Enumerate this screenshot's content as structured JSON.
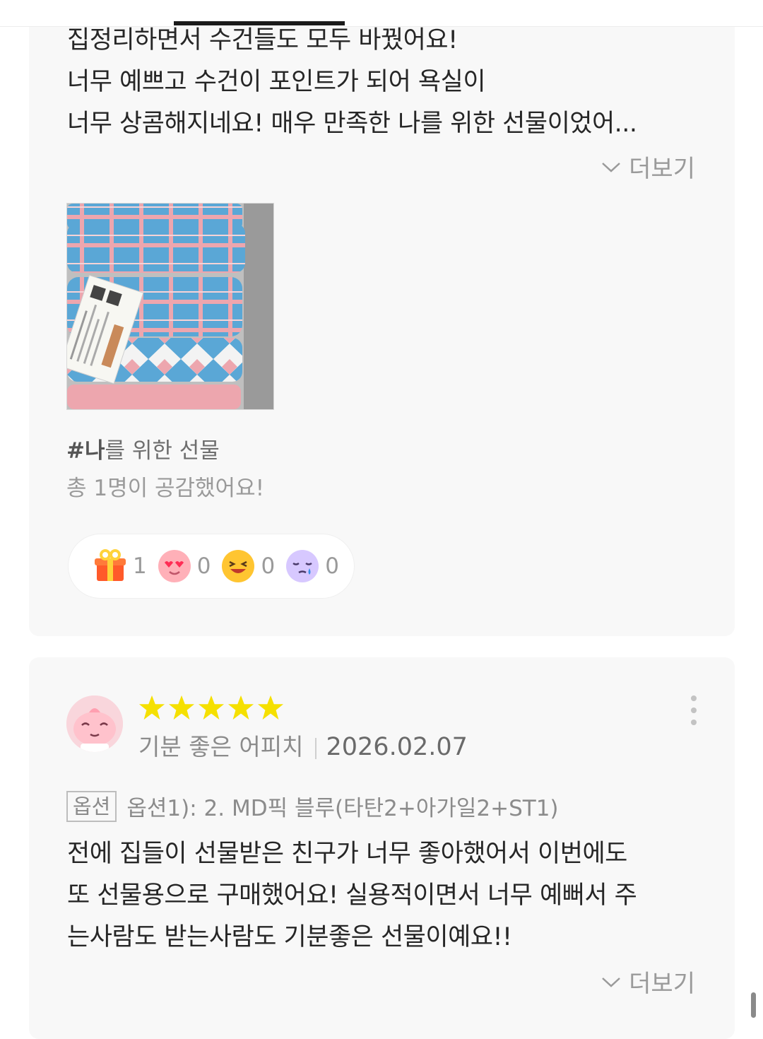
{
  "review1": {
    "lines": [
      "집정리하면서 수건들도 모두 바꿨어요!",
      "너무 예쁘고 수건이 포인트가 되어 욕실이",
      "너무 상콤해지네요! 매우 만족한 나를 위한 선물이었어..."
    ],
    "more_label": "더보기",
    "tag_hash": "#나",
    "tag_rest": "를 위한 선물",
    "empathy": "총 1명이 공감했어요!",
    "reactions": [
      {
        "icon": "gift-icon",
        "count": "1"
      },
      {
        "icon": "heart-eyes-icon",
        "count": "0"
      },
      {
        "icon": "laughing-face-icon",
        "count": "0"
      },
      {
        "icon": "crying-face-icon",
        "count": "0"
      }
    ]
  },
  "review2": {
    "rating": 5,
    "reviewer": "기분 좋은 어피치",
    "date": "2026.02.07",
    "option_badge": "옵션",
    "option_text": "옵션1): 2. MD픽 블루(타탄2+아가일2+ST1)",
    "lines": [
      "전에 집들이 선물받은 친구가 너무 좋아했어서 이번에도",
      "또 선물용으로 구매했어요! 실용적이면서 너무 예뻐서 주",
      "는사람도 받는사람도 기분좋은 선물이예요!!"
    ],
    "more_label": "더보기"
  },
  "colors": {
    "star": "#f5e000",
    "towel_blue": "#5aa7d6",
    "towel_pink": "#eda6ae"
  }
}
